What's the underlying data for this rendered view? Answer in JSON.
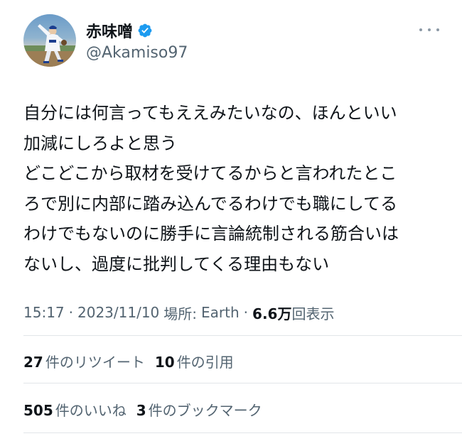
{
  "author": {
    "display_name": "赤味噌",
    "handle": "@Akamiso97",
    "avatar_icon": "avatar-baseball-pitcher",
    "verified_icon": "verified-badge-icon",
    "verified_color": "#1d9bf0"
  },
  "tweet": {
    "lines": [
      "自分には何言ってもええみたいなの、ほんといい",
      "加減にしろよと思う",
      "どこどこから取材を受けてるからと言われたとこ",
      "ろで別に内部に踏み込んでるわけでも職にしてる",
      "わけでもないのに勝手に言論統制される筋合いは",
      "ないし、過度に批判してくる理由もない"
    ]
  },
  "meta": {
    "time": "15:17",
    "separator": "·",
    "date": "2023/11/10",
    "location_label": "場所:",
    "location": "Earth",
    "views_count": "6.6万",
    "views_label": "回表示"
  },
  "stats": {
    "retweets_count": "27",
    "retweets_label": "件のリツイート",
    "quotes_count": "10",
    "quotes_label": "件の引用",
    "likes_count": "505",
    "likes_label": "件のいいね",
    "bookmarks_count": "3",
    "bookmarks_label": "件のブックマーク"
  },
  "colors": {
    "text": "#0f1419",
    "secondary": "#536471",
    "divider": "#e1e5e8",
    "accent": "#1d9bf0"
  }
}
